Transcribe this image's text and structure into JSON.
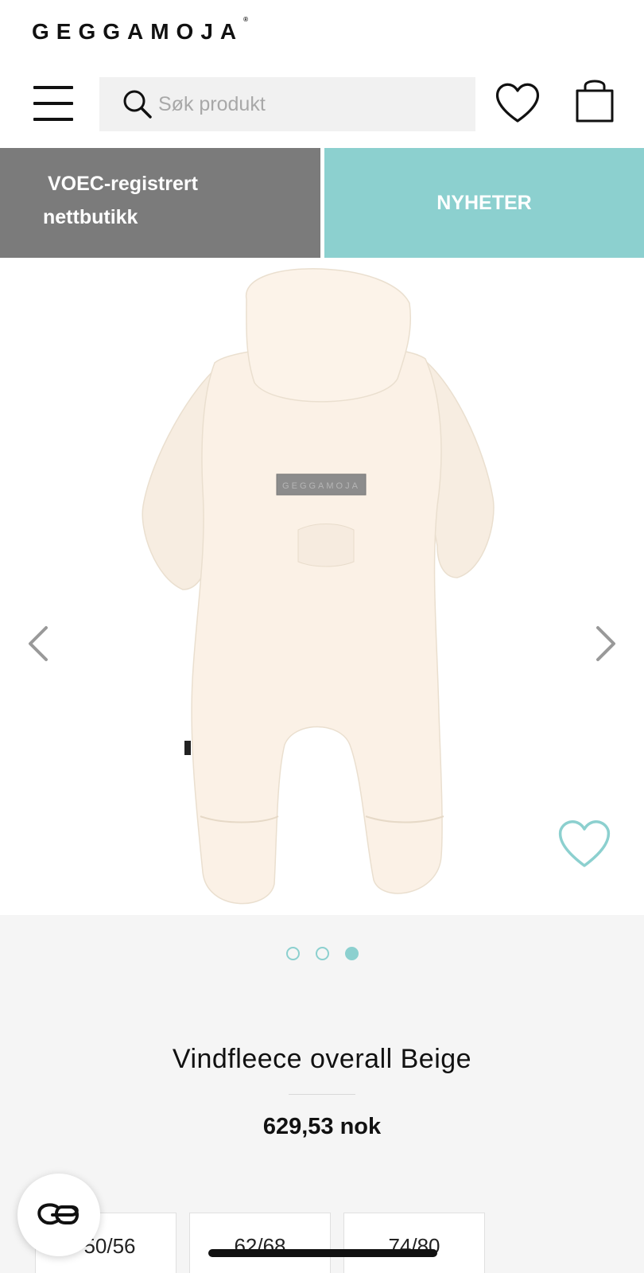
{
  "header": {
    "logo_text": "GEGGAMOJA",
    "logo_mark": "®"
  },
  "toolbar": {
    "menu_icon": "hamburger-menu-icon",
    "search_placeholder": "Søk produkt",
    "search_icon": "search-icon",
    "wishlist_icon": "heart-icon",
    "cart_icon": "shopping-bag-icon"
  },
  "promo": {
    "left_line1": "VOEC-registrert",
    "left_line2": "nettbutikk",
    "right_label": "NYHETER",
    "left_color": "#7b7b7b",
    "right_color": "#8cd0cf"
  },
  "gallery": {
    "image_label": "GEGGAMOJA",
    "prev_icon": "chevron-left-icon",
    "next_icon": "chevron-right-icon",
    "favorite_icon": "heart-outline-icon",
    "slide_count": 3,
    "active_slide": 3
  },
  "product": {
    "title": "Vindfleece overall Beige",
    "price": "629,53 nok"
  },
  "sizes": [
    "50/56",
    "62/68",
    "74/80"
  ],
  "chat": {
    "icon": "chat-logo-icon"
  },
  "colors": {
    "accent": "#8cd0cf",
    "garment": "#fbf1e6"
  }
}
